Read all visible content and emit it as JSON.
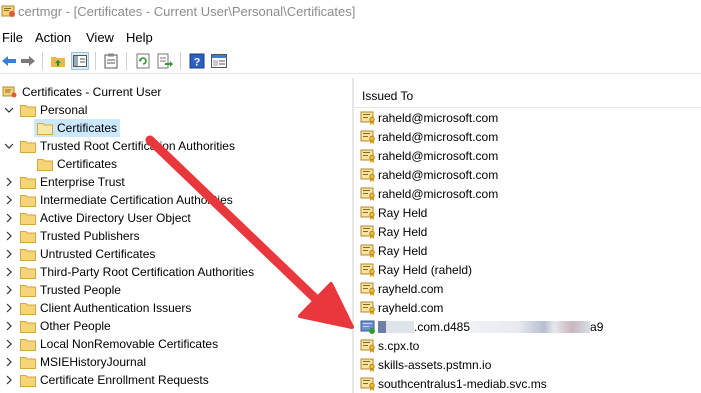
{
  "window": {
    "title": "certmgr - [Certificates - Current User\\Personal\\Certificates]"
  },
  "menu": [
    {
      "label": "File"
    },
    {
      "label": "Action"
    },
    {
      "label": "View"
    },
    {
      "label": "Help"
    }
  ],
  "toolbar": {
    "buttons": [
      "back-icon",
      "forward-icon",
      "up-folder-icon",
      "show-hide-tree-icon",
      "properties-icon",
      "refresh-icon",
      "export-list-icon",
      "help-icon",
      "console-icon"
    ]
  },
  "tree": {
    "root": "Certificates - Current User",
    "items": [
      {
        "label": "Personal",
        "expanded": true
      },
      {
        "label": "Certificates",
        "selected": true
      },
      {
        "label": "Trusted Root Certification Authorities",
        "expanded": true
      },
      {
        "label": "Certificates"
      },
      {
        "label": "Enterprise Trust"
      },
      {
        "label": "Intermediate Certification Authorities"
      },
      {
        "label": "Active Directory User Object"
      },
      {
        "label": "Trusted Publishers"
      },
      {
        "label": "Untrusted Certificates"
      },
      {
        "label": "Third-Party Root Certification Authorities"
      },
      {
        "label": "Trusted People"
      },
      {
        "label": "Client Authentication Issuers"
      },
      {
        "label": "Other People"
      },
      {
        "label": "Local NonRemovable Certificates"
      },
      {
        "label": "MSIEHistoryJournal"
      },
      {
        "label": "Certificate Enrollment Requests"
      }
    ]
  },
  "list": {
    "column_header": "Issued To",
    "rows": [
      {
        "issued_to": "raheld@microsoft.com"
      },
      {
        "issued_to": "raheld@microsoft.com"
      },
      {
        "issued_to": "raheld@microsoft.com"
      },
      {
        "issued_to": "raheld@microsoft.com"
      },
      {
        "issued_to": "raheld@microsoft.com"
      },
      {
        "issued_to": "Ray Held"
      },
      {
        "issued_to": "Ray Held"
      },
      {
        "issued_to": "Ray Held"
      },
      {
        "issued_to": "Ray Held (raheld)"
      },
      {
        "issued_to": "rayheld.com"
      },
      {
        "issued_to": "rayheld.com"
      },
      {
        "issued_to_visible_part_a": ".com.d485",
        "issued_to_visible_part_b": "a9",
        "redacted": true
      },
      {
        "issued_to": "s.cpx.to"
      },
      {
        "issued_to": "skills-assets.pstmn.io"
      },
      {
        "issued_to": "southcentralus1-mediab.svc.ms"
      }
    ]
  },
  "colors": {
    "selection": "#cce8ff",
    "folder": "#f2c94c",
    "arrow": "#e8383d",
    "title_text": "#8c8c8c"
  }
}
